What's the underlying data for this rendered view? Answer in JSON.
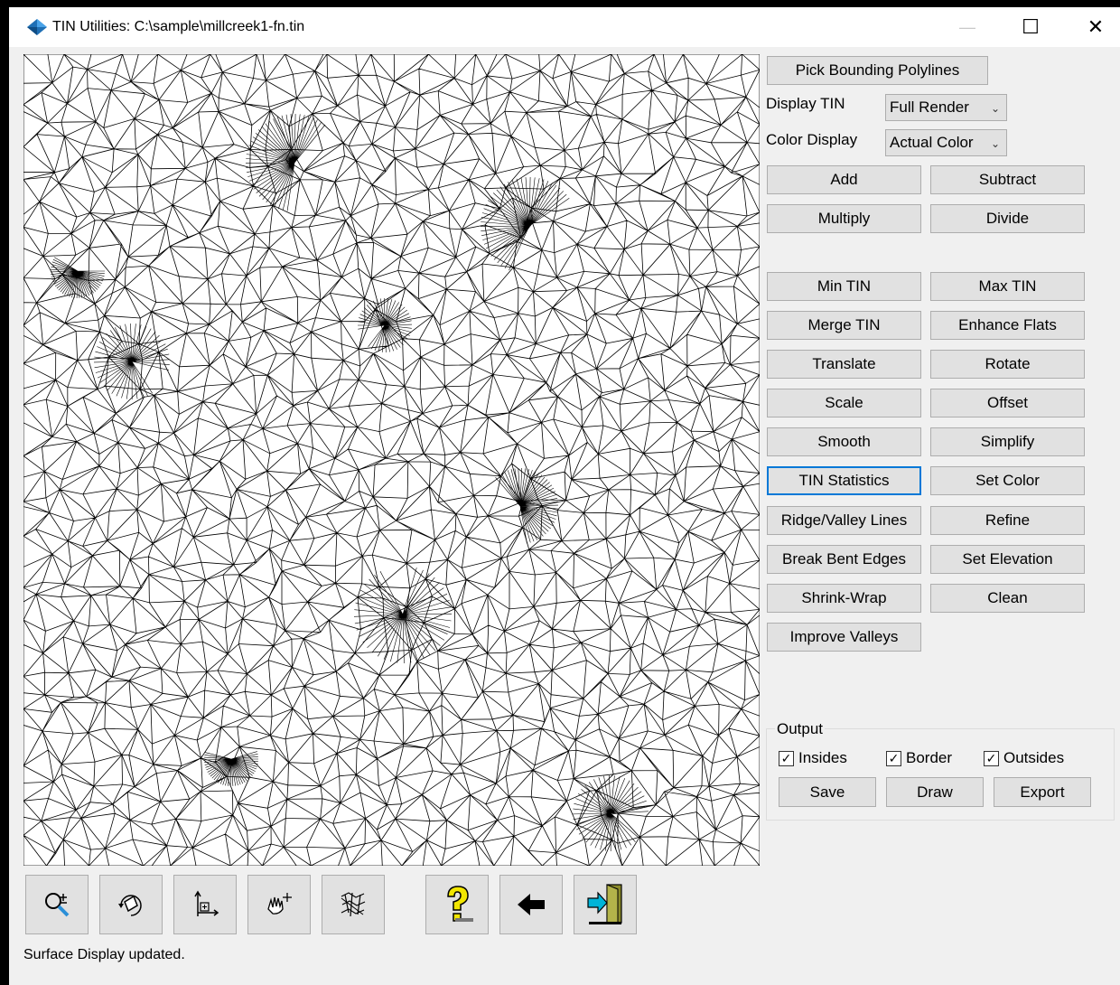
{
  "window": {
    "title": "TIN Utilities: C:\\sample\\millcreek1-fn.tin",
    "minimize": "—",
    "maximize": "☐",
    "close": "✕"
  },
  "controls": {
    "pick_bounding": "Pick Bounding Polylines",
    "display_tin_label": "Display TIN",
    "display_tin_value": "Full Render",
    "color_display_label": "Color Display",
    "color_display_value": "Actual Color",
    "dropdown_icon": "chevron-down-icon"
  },
  "buttons": {
    "add": "Add",
    "subtract": "Subtract",
    "multiply": "Multiply",
    "divide": "Divide",
    "min_tin": "Min TIN",
    "max_tin": "Max TIN",
    "merge_tin": "Merge TIN",
    "enhance_flats": "Enhance Flats",
    "translate": "Translate",
    "rotate": "Rotate",
    "scale": "Scale",
    "offset": "Offset",
    "smooth": "Smooth",
    "simplify": "Simplify",
    "tin_statistics": "TIN Statistics",
    "set_color": "Set Color",
    "ridge_valley": "Ridge/Valley Lines",
    "refine": "Refine",
    "break_bent": "Break Bent Edges",
    "set_elevation": "Set Elevation",
    "shrink_wrap": "Shrink-Wrap",
    "clean": "Clean",
    "improve_valleys": "Improve Valleys"
  },
  "output": {
    "title": "Output",
    "insides": "Insides",
    "border": "Border",
    "outsides": "Outsides",
    "insides_checked": true,
    "border_checked": true,
    "outsides_checked": true,
    "save": "Save",
    "draw": "Draw",
    "export": "Export"
  },
  "toolbar": [
    {
      "icon": "zoom-icon"
    },
    {
      "icon": "rotate-view-icon"
    },
    {
      "icon": "plan-view-icon"
    },
    {
      "icon": "pan-hand-icon"
    },
    {
      "icon": "wireframe-icon"
    },
    {
      "icon": "help-icon"
    },
    {
      "icon": "back-arrow-icon"
    },
    {
      "icon": "exit-door-icon"
    }
  ],
  "status": "Surface Display updated.",
  "colors": {
    "accent": "#0078d7",
    "button_face": "#e1e1e1",
    "help_yellow": "#f2e600",
    "exit_cyan": "#00b4d8",
    "door_olive": "#8a8a2a"
  }
}
